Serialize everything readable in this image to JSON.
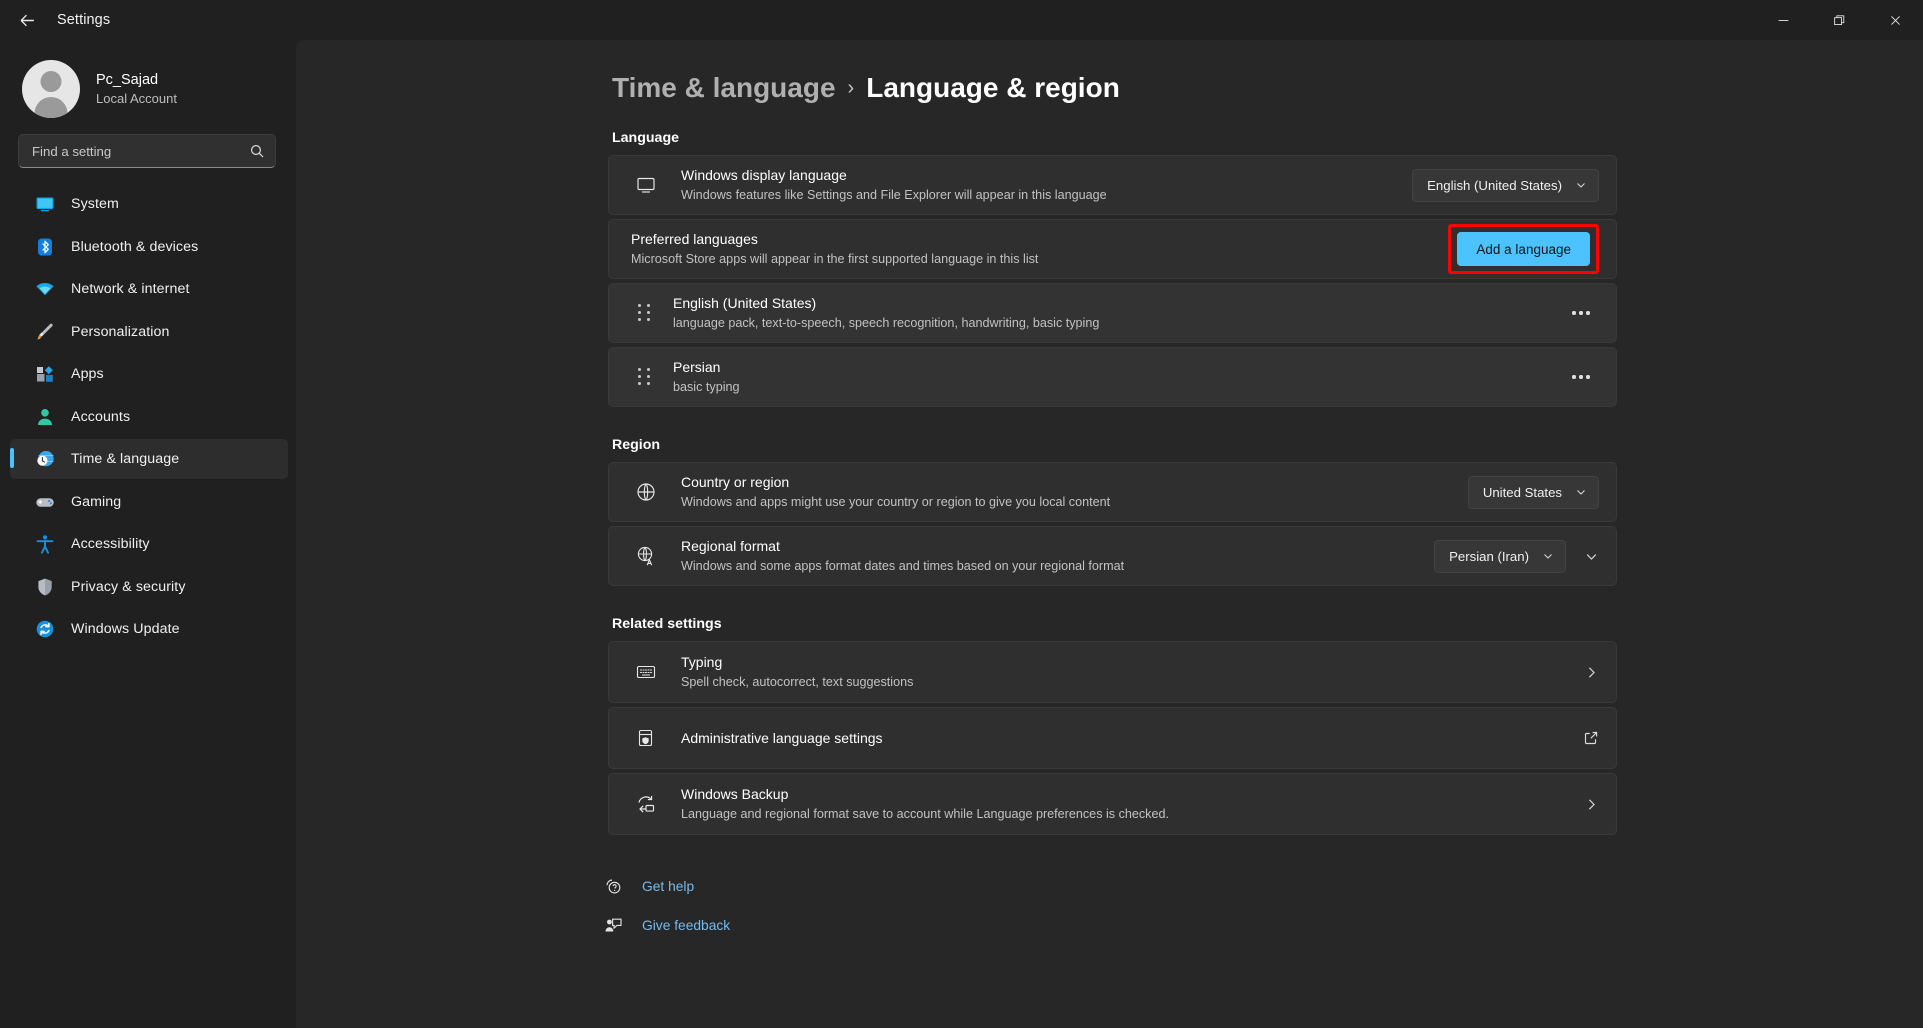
{
  "titlebar": {
    "back_label": "back-arrow",
    "app_title": "Settings",
    "minimize": "minimize",
    "maximize": "restore",
    "close": "close"
  },
  "sidebar": {
    "account": {
      "name": "Pc_Sajad",
      "type": "Local Account"
    },
    "search": {
      "placeholder": "Find a setting",
      "value": ""
    },
    "items": [
      {
        "label": "System",
        "icon": "monitor-icon",
        "active": false
      },
      {
        "label": "Bluetooth & devices",
        "icon": "bluetooth-icon",
        "active": false
      },
      {
        "label": "Network & internet",
        "icon": "wifi-icon",
        "active": false
      },
      {
        "label": "Personalization",
        "icon": "paintbrush-icon",
        "active": false
      },
      {
        "label": "Apps",
        "icon": "apps-icon",
        "active": false
      },
      {
        "label": "Accounts",
        "icon": "person-icon",
        "active": false
      },
      {
        "label": "Time & language",
        "icon": "clock-globe-icon",
        "active": true
      },
      {
        "label": "Gaming",
        "icon": "gamepad-icon",
        "active": false
      },
      {
        "label": "Accessibility",
        "icon": "accessibility-icon",
        "active": false
      },
      {
        "label": "Privacy & security",
        "icon": "shield-icon",
        "active": false
      },
      {
        "label": "Windows Update",
        "icon": "update-icon",
        "active": false
      }
    ]
  },
  "breadcrumb": {
    "parent": "Time & language",
    "separator": "›",
    "current": "Language & region"
  },
  "sections": {
    "language": {
      "title": "Language",
      "display_language": {
        "title": "Windows display language",
        "subtitle": "Windows features like Settings and File Explorer will appear in this language",
        "icon": "monitor-icon",
        "dropdown_value": "English (United States)"
      },
      "preferred": {
        "title": "Preferred languages",
        "subtitle": "Microsoft Store apps will appear in the first supported language in this list",
        "button_label": "Add a language",
        "highlighted": true
      },
      "list": [
        {
          "title": "English (United States)",
          "subtitle": "language pack, text-to-speech, speech recognition, handwriting, basic typing",
          "menu": "more-options"
        },
        {
          "title": "Persian",
          "subtitle": "basic typing",
          "menu": "more-options"
        }
      ]
    },
    "region": {
      "title": "Region",
      "rows": [
        {
          "title": "Country or region",
          "subtitle": "Windows and apps might use your country or region to give you local content",
          "icon": "globe-icon",
          "dropdown_value": "United States",
          "has_expand": false
        },
        {
          "title": "Regional format",
          "subtitle": "Windows and some apps format dates and times based on your regional format",
          "icon": "globe-translate-icon",
          "dropdown_value": "Persian (Iran)",
          "has_expand": true
        }
      ]
    },
    "related": {
      "title": "Related settings",
      "rows": [
        {
          "title": "Typing",
          "subtitle": "Spell check, autocorrect, text suggestions",
          "icon": "keyboard-icon",
          "affordance": "chevron-right"
        },
        {
          "title": "Administrative language settings",
          "subtitle": "",
          "icon": "admin-shield-icon",
          "affordance": "external-link"
        },
        {
          "title": "Windows Backup",
          "subtitle": "Language and regional format save to account while Language preferences is checked.",
          "icon": "backup-icon",
          "affordance": "chevron-right"
        }
      ]
    }
  },
  "footer_links": [
    {
      "label": "Get help",
      "icon": "help-icon"
    },
    {
      "label": "Give feedback",
      "icon": "feedback-icon"
    }
  ],
  "colors": {
    "accent": "#4cc2ff",
    "highlight_box": "#ff0000",
    "link": "#76b9ed",
    "sidebar_bg": "#202020",
    "content_bg": "#272727",
    "card_bg": "#2f2f2f"
  }
}
